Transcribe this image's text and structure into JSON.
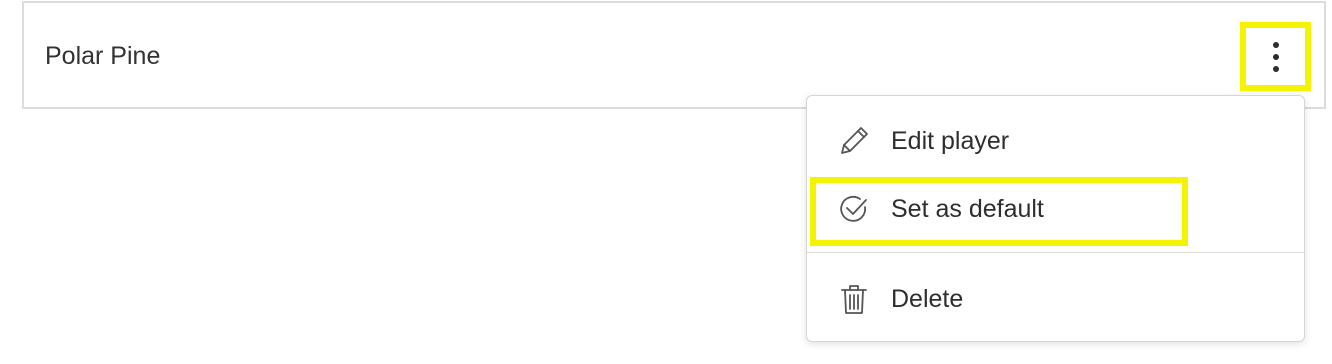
{
  "row": {
    "title": "Polar Pine"
  },
  "menu": {
    "items": [
      {
        "label": "Edit player",
        "icon": "pencil-icon"
      },
      {
        "label": "Set as default",
        "icon": "check-circle-icon"
      },
      {
        "label": "Delete",
        "icon": "trash-icon"
      }
    ]
  },
  "colors": {
    "highlight": "#f6f200",
    "text": "#2c2c2c",
    "border": "#dcdcdc"
  }
}
